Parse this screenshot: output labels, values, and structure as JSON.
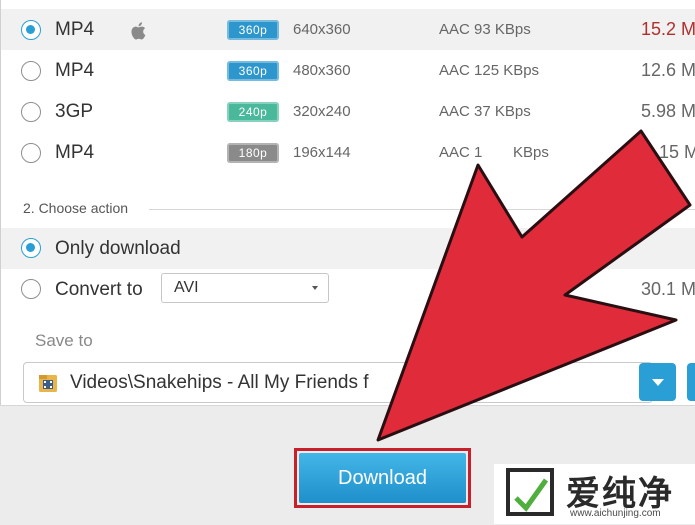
{
  "formats": [
    {
      "format": "MP4",
      "apple": true,
      "badge": "360p",
      "badge_color": "#2d97cd",
      "resolution": "640x360",
      "audio": "AAC 93  KBps",
      "size": "15.2 M",
      "size_color": "#b03030",
      "selected": true
    },
    {
      "format": "MP4",
      "apple": false,
      "badge": "360p",
      "badge_color": "#2d97cd",
      "resolution": "480x360",
      "audio": "AAC 125  KBps",
      "size": "12.6 M",
      "size_color": "#666666",
      "selected": false
    },
    {
      "format": "3GP",
      "apple": false,
      "badge": "240p",
      "badge_color": "#49b89b",
      "resolution": "320x240",
      "audio": "AAC 37  KBps",
      "size": "5.98 M",
      "size_color": "#666666",
      "selected": false
    },
    {
      "format": "MP4",
      "apple": false,
      "badge": "180p",
      "badge_color": "#8a8a8a",
      "resolution": "196x144",
      "audio": "AAC 1",
      "audio_tail": "KBps",
      "size": "15 M",
      "size_color": "#666666",
      "selected": false
    }
  ],
  "action": {
    "section_title": "2. Choose action",
    "only_download_label": "Only download",
    "convert_label": "Convert to",
    "convert_value": "AVI",
    "convert_size": "30.1 M"
  },
  "save": {
    "label": "Save to",
    "path": "Videos\\Snakehips - All My Friends f"
  },
  "download_label": "Download",
  "watermark": {
    "text": "爱纯净",
    "url": "www.aichunjing.com"
  },
  "colors": {
    "accent": "#2a9fd6",
    "arrow_fill": "#e02b3b",
    "highlight_frame": "#c8202a"
  }
}
